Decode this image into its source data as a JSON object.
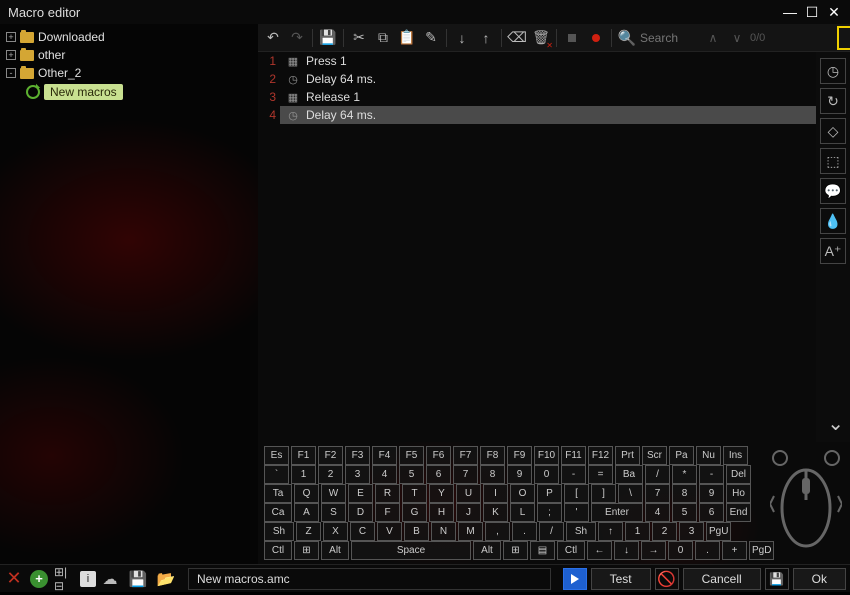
{
  "window": {
    "title": "Macro editor"
  },
  "sidebar": {
    "items": [
      {
        "label": "Downloaded"
      },
      {
        "label": "other"
      },
      {
        "label": "Other_2"
      },
      {
        "label": "New macros"
      }
    ]
  },
  "search": {
    "placeholder": "Search",
    "counter": "0/0"
  },
  "macro": {
    "lines": [
      {
        "num": "1",
        "icon": "key",
        "text": "Press 1"
      },
      {
        "num": "2",
        "icon": "clock",
        "text": "Delay 64 ms."
      },
      {
        "num": "3",
        "icon": "key",
        "text": "Release 1"
      },
      {
        "num": "4",
        "icon": "clock",
        "text": "Delay 64 ms."
      }
    ]
  },
  "keyboard": {
    "rows": [
      [
        "Es",
        "F1",
        "F2",
        "F3",
        "F4",
        "F5",
        "F6",
        "F7",
        "F8",
        "F9",
        "F10",
        "F11",
        "F12",
        "Prt",
        "Scr",
        "Pa",
        "Nu",
        "Ins"
      ],
      [
        "`",
        "1",
        "2",
        "3",
        "4",
        "5",
        "6",
        "7",
        "8",
        "9",
        "0",
        "-",
        "=",
        "Ba",
        "/",
        "*",
        "-",
        "Del"
      ],
      [
        "Ta",
        "Q",
        "W",
        "E",
        "R",
        "T",
        "Y",
        "U",
        "I",
        "O",
        "P",
        "[",
        "]",
        "\\",
        "7",
        "8",
        "9",
        "Ho"
      ],
      [
        "Ca",
        "A",
        "S",
        "D",
        "F",
        "G",
        "H",
        "J",
        "K",
        "L",
        ";",
        "'",
        "Enter",
        "4",
        "5",
        "6",
        "End"
      ],
      [
        "Sh",
        "Z",
        "X",
        "C",
        "V",
        "B",
        "N",
        "M",
        ",",
        ".",
        "/",
        "Sh",
        "↑",
        "1",
        "2",
        "3",
        "PgU"
      ],
      [
        "Ctl",
        "⊞",
        "Alt",
        "Space",
        "Alt",
        "⊞",
        "▤",
        "Ctl",
        "←",
        "↓",
        "→",
        "0",
        ".",
        "+",
        "PgD"
      ]
    ]
  },
  "bottom": {
    "filename": "New macros.amc",
    "test": "Test",
    "cancel": "Cancell",
    "ok": "Ok"
  }
}
